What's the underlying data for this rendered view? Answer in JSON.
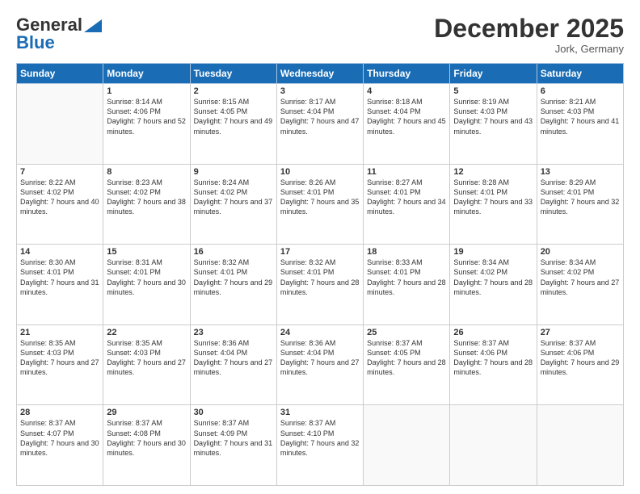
{
  "header": {
    "logo_general": "General",
    "logo_blue": "Blue",
    "month_title": "December 2025",
    "location": "Jork, Germany"
  },
  "days_of_week": [
    "Sunday",
    "Monday",
    "Tuesday",
    "Wednesday",
    "Thursday",
    "Friday",
    "Saturday"
  ],
  "weeks": [
    [
      {
        "day": "",
        "sunrise": "",
        "sunset": "",
        "daylight": ""
      },
      {
        "day": "1",
        "sunrise": "Sunrise: 8:14 AM",
        "sunset": "Sunset: 4:06 PM",
        "daylight": "Daylight: 7 hours and 52 minutes."
      },
      {
        "day": "2",
        "sunrise": "Sunrise: 8:15 AM",
        "sunset": "Sunset: 4:05 PM",
        "daylight": "Daylight: 7 hours and 49 minutes."
      },
      {
        "day": "3",
        "sunrise": "Sunrise: 8:17 AM",
        "sunset": "Sunset: 4:04 PM",
        "daylight": "Daylight: 7 hours and 47 minutes."
      },
      {
        "day": "4",
        "sunrise": "Sunrise: 8:18 AM",
        "sunset": "Sunset: 4:04 PM",
        "daylight": "Daylight: 7 hours and 45 minutes."
      },
      {
        "day": "5",
        "sunrise": "Sunrise: 8:19 AM",
        "sunset": "Sunset: 4:03 PM",
        "daylight": "Daylight: 7 hours and 43 minutes."
      },
      {
        "day": "6",
        "sunrise": "Sunrise: 8:21 AM",
        "sunset": "Sunset: 4:03 PM",
        "daylight": "Daylight: 7 hours and 41 minutes."
      }
    ],
    [
      {
        "day": "7",
        "sunrise": "Sunrise: 8:22 AM",
        "sunset": "Sunset: 4:02 PM",
        "daylight": "Daylight: 7 hours and 40 minutes."
      },
      {
        "day": "8",
        "sunrise": "Sunrise: 8:23 AM",
        "sunset": "Sunset: 4:02 PM",
        "daylight": "Daylight: 7 hours and 38 minutes."
      },
      {
        "day": "9",
        "sunrise": "Sunrise: 8:24 AM",
        "sunset": "Sunset: 4:02 PM",
        "daylight": "Daylight: 7 hours and 37 minutes."
      },
      {
        "day": "10",
        "sunrise": "Sunrise: 8:26 AM",
        "sunset": "Sunset: 4:01 PM",
        "daylight": "Daylight: 7 hours and 35 minutes."
      },
      {
        "day": "11",
        "sunrise": "Sunrise: 8:27 AM",
        "sunset": "Sunset: 4:01 PM",
        "daylight": "Daylight: 7 hours and 34 minutes."
      },
      {
        "day": "12",
        "sunrise": "Sunrise: 8:28 AM",
        "sunset": "Sunset: 4:01 PM",
        "daylight": "Daylight: 7 hours and 33 minutes."
      },
      {
        "day": "13",
        "sunrise": "Sunrise: 8:29 AM",
        "sunset": "Sunset: 4:01 PM",
        "daylight": "Daylight: 7 hours and 32 minutes."
      }
    ],
    [
      {
        "day": "14",
        "sunrise": "Sunrise: 8:30 AM",
        "sunset": "Sunset: 4:01 PM",
        "daylight": "Daylight: 7 hours and 31 minutes."
      },
      {
        "day": "15",
        "sunrise": "Sunrise: 8:31 AM",
        "sunset": "Sunset: 4:01 PM",
        "daylight": "Daylight: 7 hours and 30 minutes."
      },
      {
        "day": "16",
        "sunrise": "Sunrise: 8:32 AM",
        "sunset": "Sunset: 4:01 PM",
        "daylight": "Daylight: 7 hours and 29 minutes."
      },
      {
        "day": "17",
        "sunrise": "Sunrise: 8:32 AM",
        "sunset": "Sunset: 4:01 PM",
        "daylight": "Daylight: 7 hours and 28 minutes."
      },
      {
        "day": "18",
        "sunrise": "Sunrise: 8:33 AM",
        "sunset": "Sunset: 4:01 PM",
        "daylight": "Daylight: 7 hours and 28 minutes."
      },
      {
        "day": "19",
        "sunrise": "Sunrise: 8:34 AM",
        "sunset": "Sunset: 4:02 PM",
        "daylight": "Daylight: 7 hours and 28 minutes."
      },
      {
        "day": "20",
        "sunrise": "Sunrise: 8:34 AM",
        "sunset": "Sunset: 4:02 PM",
        "daylight": "Daylight: 7 hours and 27 minutes."
      }
    ],
    [
      {
        "day": "21",
        "sunrise": "Sunrise: 8:35 AM",
        "sunset": "Sunset: 4:03 PM",
        "daylight": "Daylight: 7 hours and 27 minutes."
      },
      {
        "day": "22",
        "sunrise": "Sunrise: 8:35 AM",
        "sunset": "Sunset: 4:03 PM",
        "daylight": "Daylight: 7 hours and 27 minutes."
      },
      {
        "day": "23",
        "sunrise": "Sunrise: 8:36 AM",
        "sunset": "Sunset: 4:04 PM",
        "daylight": "Daylight: 7 hours and 27 minutes."
      },
      {
        "day": "24",
        "sunrise": "Sunrise: 8:36 AM",
        "sunset": "Sunset: 4:04 PM",
        "daylight": "Daylight: 7 hours and 27 minutes."
      },
      {
        "day": "25",
        "sunrise": "Sunrise: 8:37 AM",
        "sunset": "Sunset: 4:05 PM",
        "daylight": "Daylight: 7 hours and 28 minutes."
      },
      {
        "day": "26",
        "sunrise": "Sunrise: 8:37 AM",
        "sunset": "Sunset: 4:06 PM",
        "daylight": "Daylight: 7 hours and 28 minutes."
      },
      {
        "day": "27",
        "sunrise": "Sunrise: 8:37 AM",
        "sunset": "Sunset: 4:06 PM",
        "daylight": "Daylight: 7 hours and 29 minutes."
      }
    ],
    [
      {
        "day": "28",
        "sunrise": "Sunrise: 8:37 AM",
        "sunset": "Sunset: 4:07 PM",
        "daylight": "Daylight: 7 hours and 30 minutes."
      },
      {
        "day": "29",
        "sunrise": "Sunrise: 8:37 AM",
        "sunset": "Sunset: 4:08 PM",
        "daylight": "Daylight: 7 hours and 30 minutes."
      },
      {
        "day": "30",
        "sunrise": "Sunrise: 8:37 AM",
        "sunset": "Sunset: 4:09 PM",
        "daylight": "Daylight: 7 hours and 31 minutes."
      },
      {
        "day": "31",
        "sunrise": "Sunrise: 8:37 AM",
        "sunset": "Sunset: 4:10 PM",
        "daylight": "Daylight: 7 hours and 32 minutes."
      },
      {
        "day": "",
        "sunrise": "",
        "sunset": "",
        "daylight": ""
      },
      {
        "day": "",
        "sunrise": "",
        "sunset": "",
        "daylight": ""
      },
      {
        "day": "",
        "sunrise": "",
        "sunset": "",
        "daylight": ""
      }
    ]
  ]
}
